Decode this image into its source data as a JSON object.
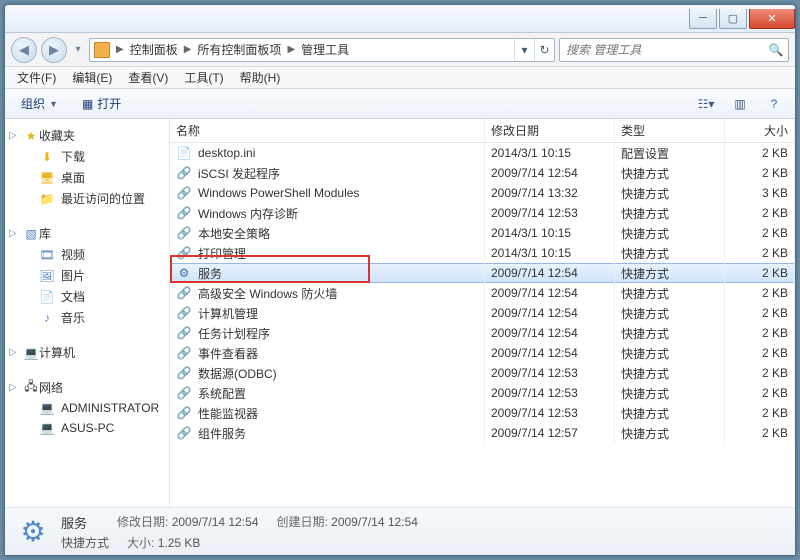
{
  "breadcrumbs": [
    "控制面板",
    "所有控制面板项",
    "管理工具"
  ],
  "search": {
    "placeholder": "搜索 管理工具"
  },
  "menus": {
    "file": "文件(F)",
    "edit": "编辑(E)",
    "view": "查看(V)",
    "tools": "工具(T)",
    "help": "帮助(H)"
  },
  "toolbar": {
    "organize": "组织",
    "open": "打开"
  },
  "sidebar": {
    "favorites": {
      "label": "收藏夹",
      "items": [
        {
          "label": "下载",
          "glyph": "⬇"
        },
        {
          "label": "桌面",
          "glyph": "🖥"
        },
        {
          "label": "最近访问的位置",
          "glyph": "📁"
        }
      ]
    },
    "libraries": {
      "label": "库",
      "items": [
        {
          "label": "视频",
          "glyph": "🎞"
        },
        {
          "label": "图片",
          "glyph": "🖼"
        },
        {
          "label": "文档",
          "glyph": "📄"
        },
        {
          "label": "音乐",
          "glyph": "♪"
        }
      ]
    },
    "computer": {
      "label": "计算机",
      "items": []
    },
    "network": {
      "label": "网络",
      "items": [
        {
          "label": "ADMINISTRATOR",
          "glyph": "💻"
        },
        {
          "label": "ASUS-PC",
          "glyph": "💻"
        }
      ]
    }
  },
  "columns": {
    "name": "名称",
    "date": "修改日期",
    "type": "类型",
    "size": "大小"
  },
  "files": [
    {
      "name": "desktop.ini",
      "date": "2014/3/1 10:15",
      "type": "配置设置",
      "size": "2 KB",
      "glyph": "📄"
    },
    {
      "name": "iSCSI 发起程序",
      "date": "2009/7/14 12:54",
      "type": "快捷方式",
      "size": "2 KB",
      "glyph": "🔗"
    },
    {
      "name": "Windows PowerShell Modules",
      "date": "2009/7/14 13:32",
      "type": "快捷方式",
      "size": "3 KB",
      "glyph": "🔗"
    },
    {
      "name": "Windows 内存诊断",
      "date": "2009/7/14 12:53",
      "type": "快捷方式",
      "size": "2 KB",
      "glyph": "🔗"
    },
    {
      "name": "本地安全策略",
      "date": "2014/3/1 10:15",
      "type": "快捷方式",
      "size": "2 KB",
      "glyph": "🔗"
    },
    {
      "name": "打印管理",
      "date": "2014/3/1 10:15",
      "type": "快捷方式",
      "size": "2 KB",
      "glyph": "🔗"
    },
    {
      "name": "服务",
      "date": "2009/7/14 12:54",
      "type": "快捷方式",
      "size": "2 KB",
      "glyph": "⚙",
      "selected": true
    },
    {
      "name": "高级安全 Windows 防火墙",
      "date": "2009/7/14 12:54",
      "type": "快捷方式",
      "size": "2 KB",
      "glyph": "🔗"
    },
    {
      "name": "计算机管理",
      "date": "2009/7/14 12:54",
      "type": "快捷方式",
      "size": "2 KB",
      "glyph": "🔗"
    },
    {
      "name": "任务计划程序",
      "date": "2009/7/14 12:54",
      "type": "快捷方式",
      "size": "2 KB",
      "glyph": "🔗"
    },
    {
      "name": "事件查看器",
      "date": "2009/7/14 12:54",
      "type": "快捷方式",
      "size": "2 KB",
      "glyph": "🔗"
    },
    {
      "name": "数据源(ODBC)",
      "date": "2009/7/14 12:53",
      "type": "快捷方式",
      "size": "2 KB",
      "glyph": "🔗"
    },
    {
      "name": "系统配置",
      "date": "2009/7/14 12:53",
      "type": "快捷方式",
      "size": "2 KB",
      "glyph": "🔗"
    },
    {
      "name": "性能监视器",
      "date": "2009/7/14 12:53",
      "type": "快捷方式",
      "size": "2 KB",
      "glyph": "🔗"
    },
    {
      "name": "组件服务",
      "date": "2009/7/14 12:57",
      "type": "快捷方式",
      "size": "2 KB",
      "glyph": "🔗"
    }
  ],
  "status": {
    "name": "服务",
    "type": "快捷方式",
    "modified_label": "修改日期:",
    "modified": "2009/7/14 12:54",
    "created_label": "创建日期:",
    "created": "2009/7/14 12:54",
    "size_label": "大小:",
    "size": "1.25 KB"
  },
  "highlight_row_index": 6
}
